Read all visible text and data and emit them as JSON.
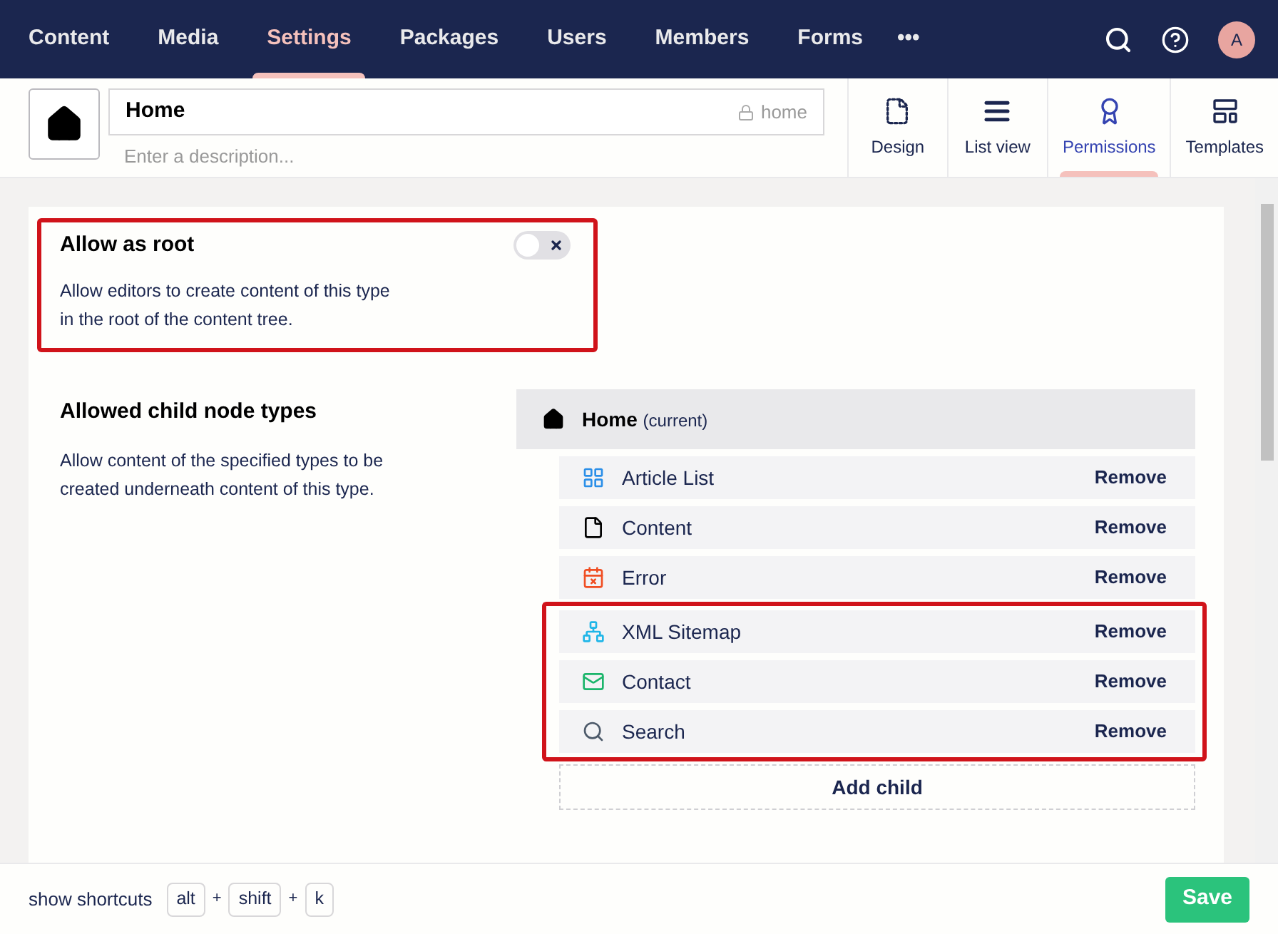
{
  "top_nav": {
    "items": [
      {
        "label": "Content",
        "selected": false
      },
      {
        "label": "Media",
        "selected": false
      },
      {
        "label": "Settings",
        "selected": true
      },
      {
        "label": "Packages",
        "selected": false
      },
      {
        "label": "Users",
        "selected": false
      },
      {
        "label": "Members",
        "selected": false
      },
      {
        "label": "Forms",
        "selected": false
      }
    ],
    "more": "•••",
    "avatar": "A"
  },
  "header": {
    "name": "Home",
    "alias": "home",
    "description_placeholder": "Enter a description...",
    "tabs": [
      {
        "label": "Design",
        "selected": false
      },
      {
        "label": "List view",
        "selected": false
      },
      {
        "label": "Permissions",
        "selected": true
      },
      {
        "label": "Templates",
        "selected": false
      }
    ]
  },
  "allow_as_root": {
    "title": "Allow as root",
    "description": "Allow editors to create content of this type in the root of the content tree.",
    "on": false,
    "highlighted": true
  },
  "allowed_child_types": {
    "title": "Allowed child node types",
    "description": "Allow content of the specified types to be created underneath content of this type.",
    "parent": {
      "name": "Home",
      "note": "(current)"
    },
    "items": [
      {
        "name": "Article List",
        "action": "Remove",
        "highlighted": false
      },
      {
        "name": "Content",
        "action": "Remove",
        "highlighted": false
      },
      {
        "name": "Error",
        "action": "Remove",
        "highlighted": false
      },
      {
        "name": "XML Sitemap",
        "action": "Remove",
        "highlighted": true
      },
      {
        "name": "Contact",
        "action": "Remove",
        "highlighted": true
      },
      {
        "name": "Search",
        "action": "Remove",
        "highlighted": true
      }
    ],
    "add_button": "Add child"
  },
  "footer": {
    "shortcuts_label": "show shortcuts",
    "shortcut": [
      {
        "kind": "key",
        "text": "alt"
      },
      {
        "kind": "plus",
        "text": "+"
      },
      {
        "kind": "key",
        "text": "shift"
      },
      {
        "kind": "plus",
        "text": "+"
      },
      {
        "kind": "key",
        "text": "k"
      }
    ],
    "save": "Save"
  }
}
